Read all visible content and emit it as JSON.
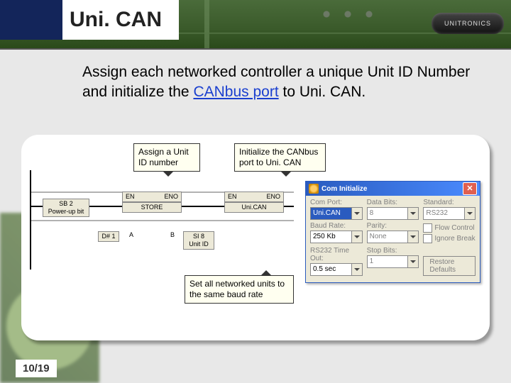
{
  "header": {
    "title": "Uni. CAN",
    "brand": "UNITRONICS"
  },
  "body_text": {
    "pre": "Assign each networked controller a unique Unit ID Number and initialize the ",
    "link": "CANbus port",
    "post": " to Uni. CAN."
  },
  "callouts": {
    "assign": "Assign a Unit ID number",
    "init": "Initialize the CANbus port to Uni. CAN",
    "baud": "Set all networked units to the same baud rate"
  },
  "ladder": {
    "powerup": "SB 2\nPower-up bit",
    "en": "EN",
    "eno": "ENO",
    "store": "STORE",
    "unican": "Uni.CAN",
    "d1": "D# 1",
    "a": "A",
    "b": "B",
    "si8": "SI 8\nUnit ID"
  },
  "dialog": {
    "title": "Com Initialize",
    "labels": {
      "comport": "Com Port:",
      "databits": "Data Bits:",
      "standard": "Standard:",
      "baudrate": "Baud Rate:",
      "parity": "Parity:",
      "flow": "Flow Control",
      "ignore": "Ignore Break",
      "rstimeout": "RS232 Time Out:",
      "stopbits": "Stop Bits:",
      "restore": "Restore Defaults"
    },
    "values": {
      "comport": "Uni.CAN",
      "databits": "8",
      "standard": "RS232",
      "baudrate": "250 Kb",
      "parity": "None",
      "rstimeout": "0.5 sec",
      "stopbits": "1"
    }
  },
  "page": "10/19"
}
